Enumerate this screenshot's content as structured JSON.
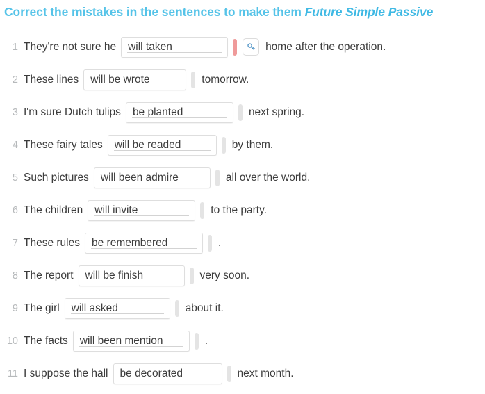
{
  "title": {
    "lead": "Correct the mistakes in the sentences to make them ",
    "tense": "Future Simple Passive"
  },
  "colors": {
    "title": "#55c3e8",
    "row_number": "#b6b9bb",
    "sentence_text": "#3c3c3c",
    "field_border": "#dedede",
    "handle": "#e4e4e4",
    "error_marker": "#ef9a9a",
    "key_icon": "#4a90c4",
    "page_background": "#ffffff"
  },
  "icons": {
    "key": "key-icon"
  },
  "exercise": {
    "rows": [
      {
        "num": "1",
        "before": "They're not sure he",
        "answer": "will taken",
        "after": "home after the operation.",
        "field_width": 154,
        "has_error_marker": true,
        "has_hint_button": true,
        "has_handle": false
      },
      {
        "num": "2",
        "before": "These lines",
        "answer": "will be wrote",
        "after": "tomorrow.",
        "field_width": 148,
        "has_error_marker": false,
        "has_hint_button": false,
        "has_handle": true
      },
      {
        "num": "3",
        "before": "I'm sure Dutch tulips",
        "answer": "be planted",
        "after": "next spring.",
        "field_width": 155,
        "has_error_marker": false,
        "has_hint_button": false,
        "has_handle": true
      },
      {
        "num": "4",
        "before": "These fairy tales",
        "answer": "will be readed",
        "after": "by them.",
        "field_width": 157,
        "has_error_marker": false,
        "has_hint_button": false,
        "has_handle": true
      },
      {
        "num": "5",
        "before": "Such pictures",
        "answer": "will been admire",
        "after": "all over the world.",
        "field_width": 168,
        "has_error_marker": false,
        "has_hint_button": false,
        "has_handle": true
      },
      {
        "num": "6",
        "before": "The children",
        "answer": "will invite",
        "after": "to the party.",
        "field_width": 155,
        "has_error_marker": false,
        "has_hint_button": false,
        "has_handle": true
      },
      {
        "num": "7",
        "before": "These rules",
        "answer": "be remembered",
        "after": ".",
        "field_width": 170,
        "has_error_marker": false,
        "has_hint_button": false,
        "has_handle": true
      },
      {
        "num": "8",
        "before": "The report",
        "answer": "will be finish",
        "after": "very soon.",
        "field_width": 153,
        "has_error_marker": false,
        "has_hint_button": false,
        "has_handle": true
      },
      {
        "num": "9",
        "before": "The girl",
        "answer": "will asked",
        "after": "about it.",
        "field_width": 152,
        "has_error_marker": false,
        "has_hint_button": false,
        "has_handle": true
      },
      {
        "num": "10",
        "before": "The facts",
        "answer": "will been mention",
        "after": ".",
        "field_width": 168,
        "has_error_marker": false,
        "has_hint_button": false,
        "has_handle": true
      },
      {
        "num": "11",
        "before": "I suppose the hall",
        "answer": "be decorated",
        "after": "next month.",
        "field_width": 157,
        "has_error_marker": false,
        "has_hint_button": false,
        "has_handle": true
      }
    ]
  }
}
